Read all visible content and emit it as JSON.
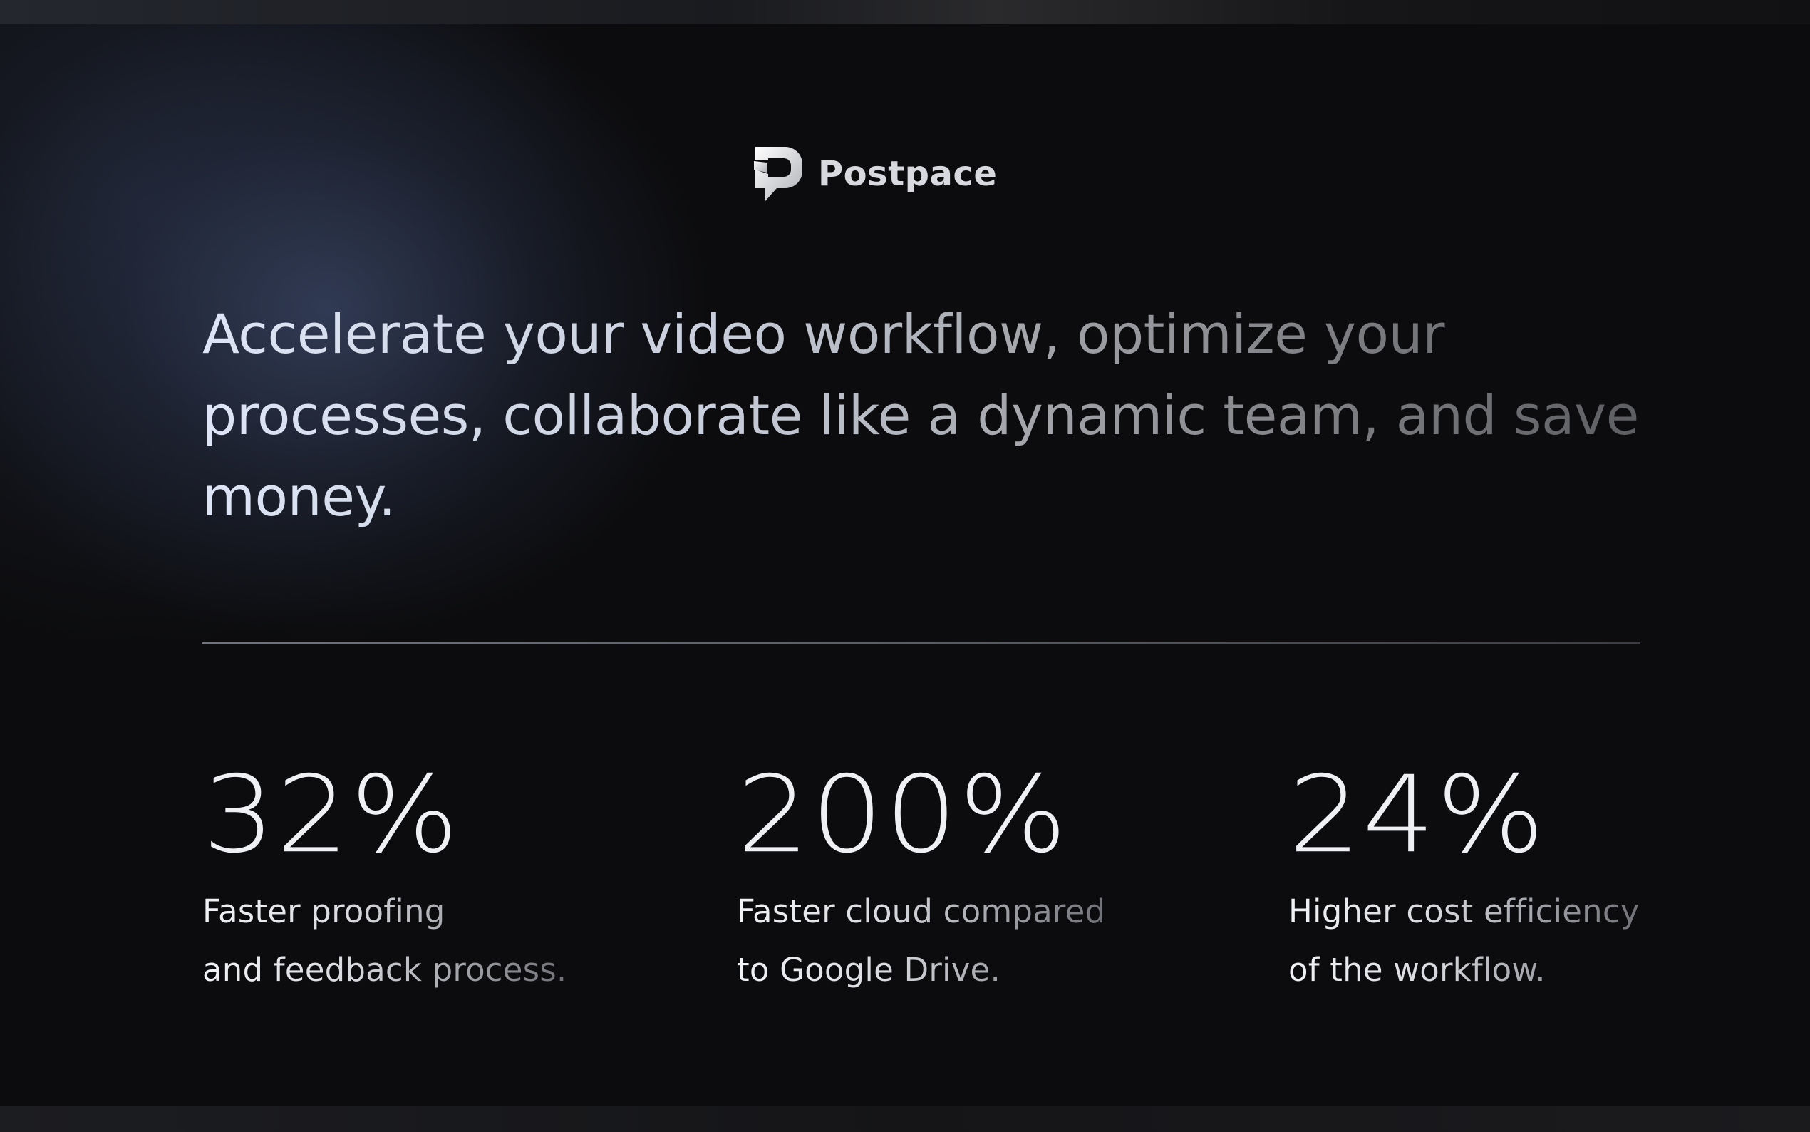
{
  "brand": {
    "logo_icon": "postpace-logo-icon",
    "name": "Postpace"
  },
  "headline": "Accelerate your video workflow, optimize your processes, collaborate like a dynamic team, and save money.",
  "stats": [
    {
      "value": "32%",
      "line1": "Faster proofing",
      "line2": "and feedback process."
    },
    {
      "value": "200%",
      "line1": "Faster cloud compared",
      "line2": "to Google Drive."
    },
    {
      "value": "24%",
      "line1": "Higher cost efficiency",
      "line2": "of the workflow."
    }
  ],
  "colors": {
    "background": "#0c0c0e",
    "glow": "#485880",
    "text": "#e6e8ee"
  }
}
